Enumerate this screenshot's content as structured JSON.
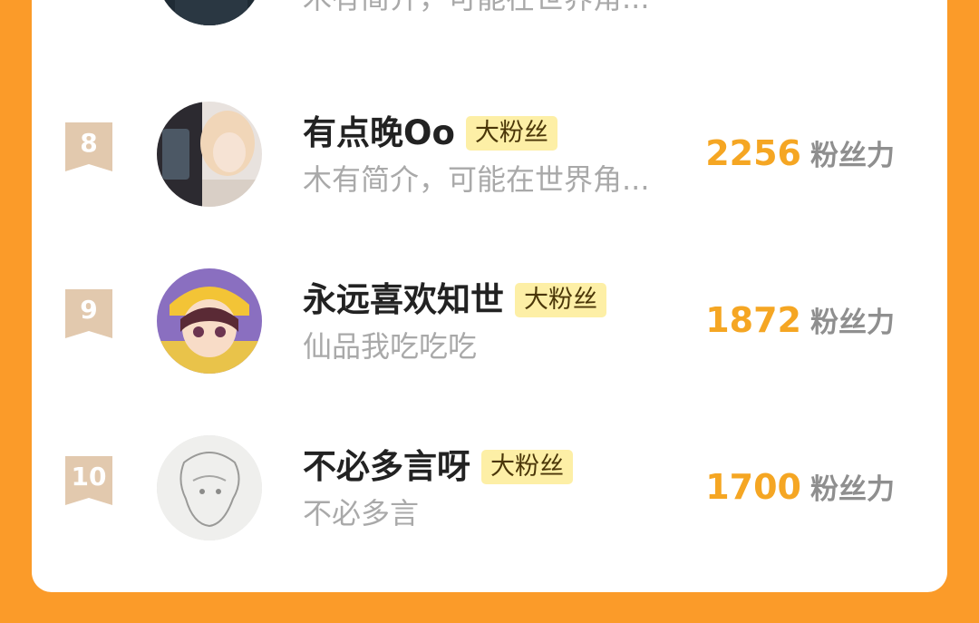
{
  "top_partial": {
    "desc": "木有简介，可能在世界角..."
  },
  "rows": [
    {
      "rank": "8",
      "name": "有点晚Oo",
      "badge": "大粉丝",
      "desc": "木有简介，可能在世界角...",
      "score": "2256",
      "unit": "粉丝力"
    },
    {
      "rank": "9",
      "name": "永远喜欢知世",
      "badge": "大粉丝",
      "desc": "仙品我吃吃吃",
      "score": "1872",
      "unit": "粉丝力"
    },
    {
      "rank": "10",
      "name": "不必多言呀",
      "badge": "大粉丝",
      "desc": "不必多言",
      "score": "1700",
      "unit": "粉丝力"
    }
  ],
  "colors": {
    "page_bg": "#fb9b29",
    "card_bg": "#ffffff",
    "rank_ribbon": "#e2c9ae",
    "badge_bg": "#fdefa6",
    "score": "#f5a623",
    "desc": "#a9a9a9"
  }
}
